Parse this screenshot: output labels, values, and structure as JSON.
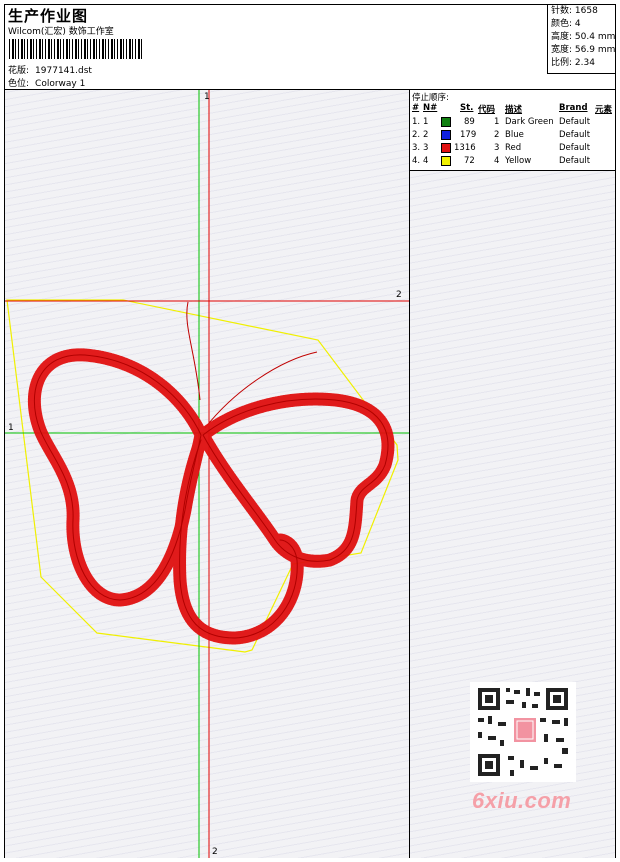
{
  "header": {
    "title": "生产作业图",
    "subtitle": "Wilcom(汇宏) 数饰工作室",
    "design_label": "花版:",
    "design_value": "1977141.dst",
    "colorway_label": "色位:",
    "colorway_value": "Colorway 1"
  },
  "stats": [
    {
      "label": "针数:",
      "value": "1658"
    },
    {
      "label": "颜色:",
      "value": "4"
    },
    {
      "label": "高度:",
      "value": "50.4 mm"
    },
    {
      "label": "宽度:",
      "value": "56.9 mm"
    },
    {
      "label": "比例:",
      "value": "2.34"
    }
  ],
  "stop_sequence": {
    "title": "停止顺序:",
    "headers": {
      "num": "#",
      "n": "N#",
      "st": "St.",
      "code": "代码",
      "desc": "描述",
      "brand": "Brand",
      "elem": "元素"
    },
    "rows": [
      {
        "num": "1.",
        "n": "1",
        "st": "89",
        "code": "1",
        "desc": "Dark Green",
        "brand": "Default",
        "color": "#108010"
      },
      {
        "num": "2.",
        "n": "2",
        "st": "179",
        "code": "2",
        "desc": "Blue",
        "brand": "Default",
        "color": "#1020e0"
      },
      {
        "num": "3.",
        "n": "3",
        "st": "1316",
        "code": "3",
        "desc": "Red",
        "brand": "Default",
        "color": "#e01010"
      },
      {
        "num": "4.",
        "n": "4",
        "st": "72",
        "code": "4",
        "desc": "Yellow",
        "brand": "Default",
        "color": "#f0f000"
      }
    ]
  },
  "guides": {
    "v_top": "1",
    "v_bottom": "2",
    "h_left": "1",
    "h_right": "2"
  },
  "colors": {
    "stitch_red": "#e01010",
    "guide_green": "#00c000",
    "guide_red": "#e00000",
    "outline_yellow": "#f0f000"
  },
  "watermark": "6xiu.com"
}
